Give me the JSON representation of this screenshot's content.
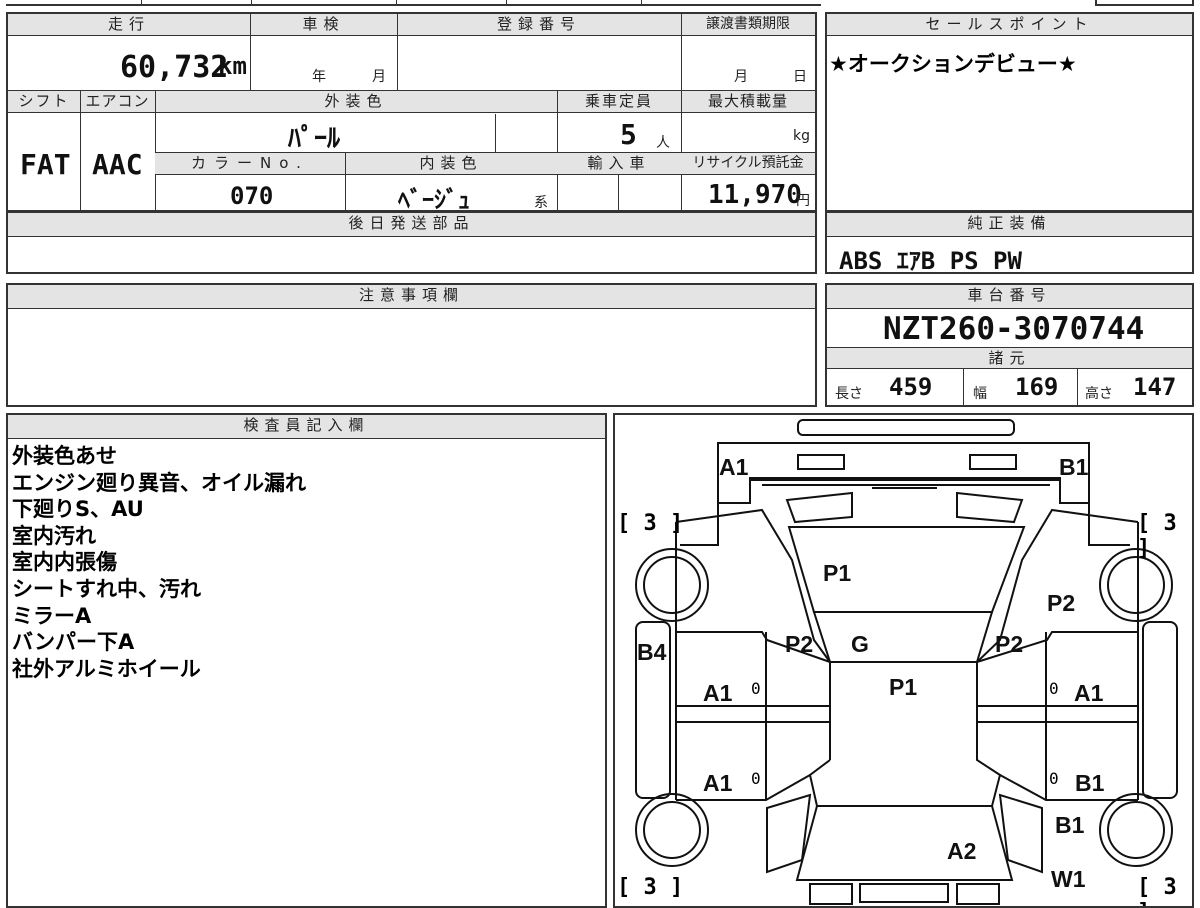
{
  "header": {
    "mileage_label": "走行",
    "shaken_label": "車検",
    "reg_no_label": "登録番号",
    "transfer_deadline_label": "譲渡書類期限",
    "sales_point_label": "セールスポイント"
  },
  "mileage": "60,732",
  "mileage_unit": "km",
  "shaken_year_unit": "年",
  "shaken_month_unit": "月",
  "transfer_month_unit": "月",
  "transfer_day_unit": "日",
  "spec_labels": {
    "shift": "シフト",
    "aircon": "エアコン",
    "exterior_color": "外装色",
    "capacity": "乗車定員",
    "max_load": "最大積載量",
    "color_no": "カラーNo.",
    "interior_color": "内装色",
    "import": "輸入車",
    "recycle_fee": "リサイクル預託金"
  },
  "shift": "FAT",
  "aircon": "AAC",
  "exterior_color": "ﾊﾟｰﾙ",
  "capacity": "5",
  "capacity_unit": "人",
  "max_load_unit": "kg",
  "color_no": "070",
  "interior_color": "ﾍﾞｰｼﾞｭ",
  "interior_color_suffix": "系",
  "recycle_fee": "11,970",
  "recycle_fee_unit": "円",
  "later_parts_label": "後日発送部品",
  "sales_point": "★オークションデビュー★",
  "std_equipment_label": "純正装備",
  "std_equipment": "ABS ｴｱB PS PW",
  "notes_label": "注意事項欄",
  "chassis_no_label": "車台番号",
  "chassis_no": "NZT260-3070744",
  "specs_label": "諸元",
  "length_label": "長さ",
  "length": "459",
  "width_label": "幅",
  "width": "169",
  "height_label": "高さ",
  "height": "147",
  "inspector_label": "検査員記入欄",
  "inspector_notes": [
    "外装色あせ",
    "エンジン廻り異音、オイル漏れ",
    "下廻りS、AU",
    "室内汚れ",
    "室内内張傷",
    "シートすれ中、汚れ",
    "ミラーA",
    "バンパー下A",
    "社外アルミホイール"
  ],
  "diagram": {
    "marks": [
      "A1",
      "B1",
      "P1",
      "P2",
      "P2",
      "G",
      "P2",
      "B4",
      "A1",
      "P1",
      "A1",
      "A1",
      "B1",
      "B1",
      "A2",
      "W1"
    ],
    "tire_tread": [
      "3",
      "3",
      "3",
      "3"
    ],
    "zero_marks": [
      "0",
      "0",
      "0",
      "0"
    ]
  }
}
